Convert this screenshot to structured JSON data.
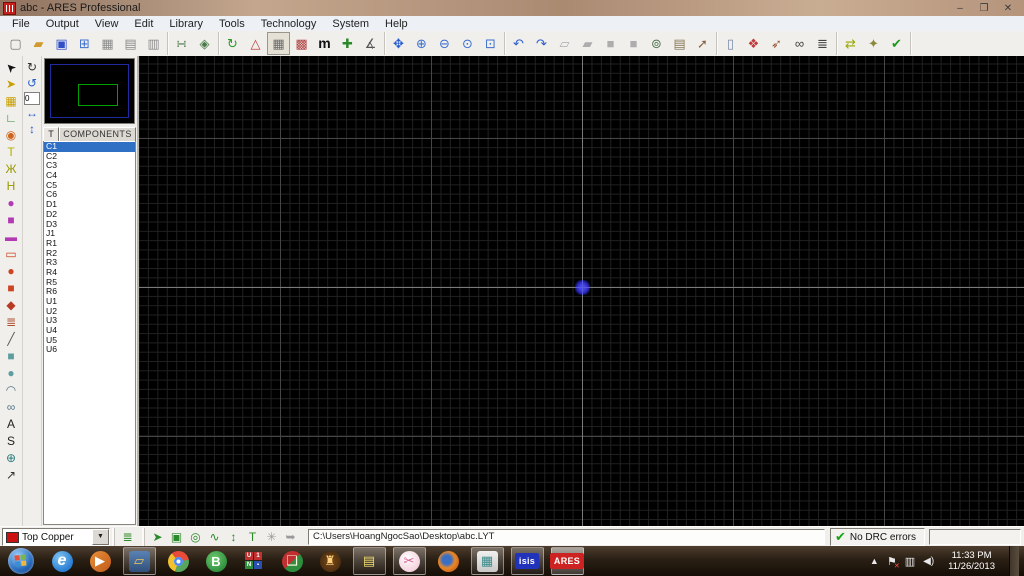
{
  "window": {
    "title": "abc - ARES Professional",
    "controls": [
      {
        "n": "minimize-button",
        "g": "–"
      },
      {
        "n": "restore-button",
        "g": "❐"
      },
      {
        "n": "close-button",
        "g": "✕"
      }
    ]
  },
  "menu": {
    "items": [
      "File",
      "Output",
      "View",
      "Edit",
      "Library",
      "Tools",
      "Technology",
      "System",
      "Help"
    ]
  },
  "toolbar": {
    "groups": [
      {
        "items": [
          {
            "n": "new-file-icon",
            "g": "▢",
            "c": "#7a7a7a"
          },
          {
            "n": "open-file-icon",
            "g": "▰",
            "c": "#cf9b2f"
          },
          {
            "n": "save-file-icon",
            "g": "▣",
            "c": "#3050c8"
          },
          {
            "n": "import-region-icon",
            "g": "⊞",
            "c": "#3a6fd0"
          },
          {
            "n": "export-region-icon",
            "g": "▦",
            "c": "#8a8a8a"
          },
          {
            "n": "print-icon",
            "g": "▤",
            "c": "#8a8a8a"
          },
          {
            "n": "print-area-icon",
            "g": "▥",
            "c": "#8a8a8a"
          }
        ]
      },
      {
        "items": [
          {
            "n": "netlist-load-icon",
            "g": "∺",
            "c": "#4a7a4a"
          },
          {
            "n": "netlist-tools-icon",
            "g": "◈",
            "c": "#4a7a4a"
          }
        ]
      },
      {
        "items": [
          {
            "n": "redraw-icon",
            "g": "↻",
            "c": "#2a9a2a"
          },
          {
            "n": "flip-layers-icon",
            "g": "△",
            "c": "#c04040"
          },
          {
            "n": "grid-toggle-icon",
            "g": "▦",
            "c": "#6a6a6a",
            "active": true
          },
          {
            "n": "false-origin-icon",
            "g": "▩",
            "c": "#b04040"
          },
          {
            "n": "metric-toggle-icon",
            "g": "m",
            "c": "#111111",
            "bold": true
          },
          {
            "n": "polar-origin-icon",
            "g": "✚",
            "c": "#2a8a2a"
          },
          {
            "n": "goto-xy-icon",
            "g": "∡",
            "c": "#555555"
          }
        ]
      },
      {
        "items": [
          {
            "n": "pan-icon",
            "g": "✥",
            "c": "#2a5fd0"
          },
          {
            "n": "zoom-in-icon",
            "g": "⊕",
            "c": "#3a6fd0"
          },
          {
            "n": "zoom-out-icon",
            "g": "⊖",
            "c": "#3a6fd0"
          },
          {
            "n": "zoom-all-icon",
            "g": "⊙",
            "c": "#3a6fd0"
          },
          {
            "n": "zoom-area-icon",
            "g": "⊡",
            "c": "#3a6fd0"
          }
        ]
      },
      {
        "items": [
          {
            "n": "undo-icon",
            "g": "↶",
            "c": "#2a5fd0"
          },
          {
            "n": "redo-icon",
            "g": "↷",
            "c": "#2a5fd0"
          },
          {
            "n": "cut-region-icon",
            "g": "▱",
            "c": "#9a9a9a",
            "disabled": true
          },
          {
            "n": "copy-region-icon",
            "g": "▰",
            "c": "#9a9a9a",
            "disabled": true
          },
          {
            "n": "paste-region-icon",
            "g": "■",
            "c": "#9a9a9a",
            "disabled": true
          },
          {
            "n": "clear-region-icon",
            "g": "■",
            "c": "#9a9a9a",
            "disabled": true
          },
          {
            "n": "zoom-region-icon",
            "g": "⊚",
            "c": "#557755"
          },
          {
            "n": "stamp-region-icon",
            "g": "▤",
            "c": "#887755"
          },
          {
            "n": "pick-tool-icon",
            "g": "➚",
            "c": "#886644"
          }
        ]
      },
      {
        "items": [
          {
            "n": "design-explorer-icon",
            "g": "▯",
            "c": "#7788aa"
          },
          {
            "n": "auto-placer-icon",
            "g": "❖",
            "c": "#c03a3a"
          },
          {
            "n": "auto-router-icon",
            "g": "➶",
            "c": "#995533"
          },
          {
            "n": "search-components-icon",
            "g": "∞",
            "c": "#444444"
          },
          {
            "n": "auto-annotate-icon",
            "g": "≣",
            "c": "#444444"
          }
        ]
      },
      {
        "items": [
          {
            "n": "ratsnest-recompile-icon",
            "g": "⇄",
            "c": "#9aa800"
          },
          {
            "n": "gateswap-icon",
            "g": "✦",
            "c": "#8a8a3a"
          },
          {
            "n": "drc-check-icon",
            "g": "✔",
            "c": "#1a9a1a"
          }
        ]
      }
    ]
  },
  "side_toolbar": {
    "items": [
      {
        "n": "selection-tool-icon",
        "g": "➤",
        "c": "#111111",
        "rot": -135
      },
      {
        "n": "component-mode-icon",
        "g": "➤",
        "c": "#c8a000"
      },
      {
        "n": "package-mode-icon",
        "g": "▦",
        "c": "#c8a000"
      },
      {
        "n": "trace-mode-icon",
        "g": "∟",
        "c": "#2a8a2a"
      },
      {
        "n": "via-mode-icon",
        "g": "◉",
        "c": "#cc6622"
      },
      {
        "n": "zone-mode-icon",
        "g": "T",
        "c": "#b0b000",
        "bold": true
      },
      {
        "n": "ratsnest-mode-icon",
        "g": "Ж",
        "c": "#999900"
      },
      {
        "n": "connectivity-mode-icon",
        "g": "H",
        "c": "#999900",
        "bold": true
      },
      {
        "n": "round-pad-icon",
        "g": "●",
        "c": "#b23ab2"
      },
      {
        "n": "square-pad-icon",
        "g": "■",
        "c": "#b23ab2"
      },
      {
        "n": "dil-pad-icon",
        "g": "▬",
        "c": "#b23ab2"
      },
      {
        "n": "edge-connector-pad-icon",
        "g": "▭",
        "c": "#cc4422"
      },
      {
        "n": "circular-smt-pad-icon",
        "g": "●",
        "c": "#cc4422"
      },
      {
        "n": "rect-smt-pad-icon",
        "g": "■",
        "c": "#cc4422"
      },
      {
        "n": "polygonal-pad-icon",
        "g": "◆",
        "c": "#b83a22"
      },
      {
        "n": "padstack-icon",
        "g": "≣",
        "c": "#b05030"
      },
      {
        "n": "line-2d-icon",
        "g": "╱",
        "c": "#555555"
      },
      {
        "n": "box-2d-icon",
        "g": "■",
        "c": "#5f9ea0"
      },
      {
        "n": "circle-2d-icon",
        "g": "●",
        "c": "#5f9ea0"
      },
      {
        "n": "arc-2d-icon",
        "g": "◠",
        "c": "#557788"
      },
      {
        "n": "path-2d-icon",
        "g": "∞",
        "c": "#557788"
      },
      {
        "n": "text-2d-icon",
        "g": "A",
        "c": "#222222",
        "bold": true
      },
      {
        "n": "symbol-2d-icon",
        "g": "S",
        "c": "#222222",
        "bold": true
      },
      {
        "n": "marker-2d-icon",
        "g": "⊕",
        "c": "#2a7a7a"
      },
      {
        "n": "dimension-2d-icon",
        "g": "↗",
        "c": "#333333"
      }
    ]
  },
  "rotation": {
    "upper": [
      {
        "n": "rotate-cw-icon",
        "g": "↻",
        "c": "#333333"
      },
      {
        "n": "rotate-ccw-icon",
        "g": "↺",
        "c": "#2a5fd0"
      }
    ],
    "angle_value": "0",
    "lower": [
      {
        "n": "mirror-horizontal-icon",
        "g": "↔",
        "c": "#2a5fd0"
      },
      {
        "n": "mirror-vertical-icon",
        "g": "↕",
        "c": "#2a5fd0"
      }
    ]
  },
  "components_panel": {
    "toggle_label": "T",
    "header": "COMPONENTS",
    "selected": "C1",
    "items": [
      "C1",
      "C2",
      "C3",
      "C4",
      "C5",
      "C6",
      "D1",
      "D2",
      "D3",
      "J1",
      "R1",
      "R2",
      "R3",
      "R4",
      "R5",
      "R6",
      "U1",
      "U2",
      "U3",
      "U4",
      "U5",
      "U6"
    ]
  },
  "canvas": {
    "bg": "#000000",
    "grid_minor": "#212121",
    "grid_major": "#464646",
    "axis": "#7a7a7a",
    "origin_color": "#2626b4"
  },
  "status_bar": {
    "layer_selector": {
      "value": "Top Copper",
      "swatch": "#cc1111",
      "dropdown_glyph": "▼"
    },
    "layers_icon": {
      "n": "layer-stack-icon",
      "g": "≣",
      "c": "#2a8a2a"
    },
    "filters": [
      {
        "n": "filter-component-icon",
        "g": "➤",
        "c": "#2a8a2a"
      },
      {
        "n": "filter-pad-icon",
        "g": "▣",
        "c": "#2a8a2a"
      },
      {
        "n": "filter-via-icon",
        "g": "◎",
        "c": "#2a8a2a"
      },
      {
        "n": "filter-trace-icon",
        "g": "∿",
        "c": "#2a8a2a"
      },
      {
        "n": "filter-drag-icon",
        "g": "↕",
        "c": "#2a8a2a"
      },
      {
        "n": "filter-zone-icon",
        "g": "T",
        "c": "#2a8a2a",
        "bold": true
      },
      {
        "n": "filter-ratsnest-icon",
        "g": "✳",
        "c": "#9a9a9a",
        "dim": true
      },
      {
        "n": "filter-track-icon",
        "g": "➥",
        "c": "#9a9a9a",
        "dim": true
      }
    ],
    "file_path": "C:\\Users\\HoangNgocSao\\Desktop\\abc.LYT",
    "drc_check_glyph": "✔",
    "drc_status": "No DRC errors"
  },
  "taskbar": {
    "items": [
      {
        "n": "start-button",
        "t": "orb"
      },
      {
        "n": "internet-explorer-taskbar-icon",
        "g": "e",
        "fg": "#ffffff",
        "bg": "radial-gradient(circle at 35% 30%,#7ec2f0,#2a7fd4 70%)",
        "round": true,
        "italic": true
      },
      {
        "n": "media-player-taskbar-icon",
        "g": "▶",
        "fg": "#ffffff",
        "bg": "linear-gradient(135deg,#e8903a,#c05a1a)",
        "round": true
      },
      {
        "n": "explorer-taskbar-icon",
        "g": "▱",
        "fg": "#edc95a",
        "bg": "linear-gradient(180deg,#5a82b5,#31507a)",
        "boxed": true
      },
      {
        "n": "chrome-taskbar-icon",
        "t": "chrome"
      },
      {
        "n": "green-browser-taskbar-icon",
        "g": "B",
        "fg": "#ffffff",
        "bg": "radial-gradient(circle at 40% 35%,#6cc96c,#2e8e3e 75%)",
        "round": true
      },
      {
        "n": "unikey-taskbar-icon",
        "t": "unikey"
      },
      {
        "n": "gift-app-taskbar-icon",
        "g": "❑",
        "fg": "#fff8e0",
        "bg": "linear-gradient(135deg,#c03030 50%,#2e8e3e 50%)",
        "round": true
      },
      {
        "n": "game-app-taskbar-icon",
        "g": "♜",
        "fg": "#ffd27a",
        "bg": "radial-gradient(circle,#7a4a1a,#3a230c)",
        "round": true
      },
      {
        "n": "sticky-notes-taskbar-icon",
        "g": "▤",
        "fg": "#f0dc6a",
        "bg": "transparent",
        "boxed": true
      },
      {
        "n": "snipping-tool-taskbar-icon",
        "g": "✂",
        "fg": "#d65a8a",
        "bg": "radial-gradient(circle at 40% 35%,#ffffff,#f0c0d0)",
        "round": true,
        "boxed": true
      },
      {
        "n": "firefox-taskbar-icon",
        "t": "firefox"
      },
      {
        "n": "pcb-editor-taskbar-icon",
        "g": "▦",
        "fg": "#3a8a8a",
        "bg": "linear-gradient(180deg,#f0f0f0,#c8c8c8)",
        "boxed": true
      },
      {
        "n": "isis-taskbar-icon",
        "l": "isis",
        "fg": "#ffffff",
        "bg": "#2233bb",
        "boxed": true
      },
      {
        "n": "ares-taskbar-icon",
        "l": "ARES",
        "fg": "#ffffff",
        "bg": "#cc2222",
        "boxed": true,
        "active": true
      }
    ],
    "unikey_cells": [
      {
        "g": "U",
        "bg": "#c03030"
      },
      {
        "g": "1",
        "bg": "#c03030"
      },
      {
        "g": "N",
        "bg": "#2e8e3e"
      },
      {
        "g": "▪",
        "bg": "#2a4fb0"
      }
    ],
    "start_flag_colors": [
      "#e4513c",
      "#7ab648",
      "#3a8fd4",
      "#f0b83a"
    ],
    "tray": {
      "chevron_glyph": "▲",
      "flag_glyph": "⚑",
      "flag_badge": "✕",
      "network_glyph": "▥",
      "speaker_glyph": "◀)",
      "time": "11:33 PM",
      "date": "11/26/2013"
    }
  }
}
